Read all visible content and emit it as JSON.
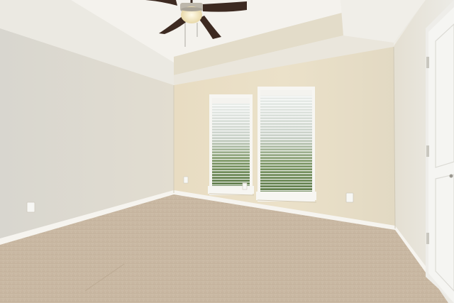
{
  "scene": {
    "kind": "empty-bedroom-photo",
    "colors": {
      "ceiling": "#f2f1ec",
      "tray_ceiling": "#f6f4ee",
      "left_wall": "#dcdad3",
      "back_wall": "#e7ddc4",
      "right_wall": "#e2ddd0",
      "carpet": "#c9b8a3",
      "trim": "#f5f3ee",
      "door": "#f4f4f1",
      "fan_blade": "#3d2a21",
      "fan_light": "#f7edd0",
      "window_foliage": "#6f8a55"
    },
    "objects": [
      {
        "name": "ceiling-fan",
        "blade_count": 4,
        "light_on": true
      },
      {
        "name": "window",
        "count": 2,
        "covering": "horizontal-blinds"
      },
      {
        "name": "door",
        "state": "closed",
        "panels": 2
      },
      {
        "name": "outlet",
        "count": 4
      },
      {
        "name": "carpet",
        "type": "beige-wall-to-wall"
      }
    ]
  }
}
